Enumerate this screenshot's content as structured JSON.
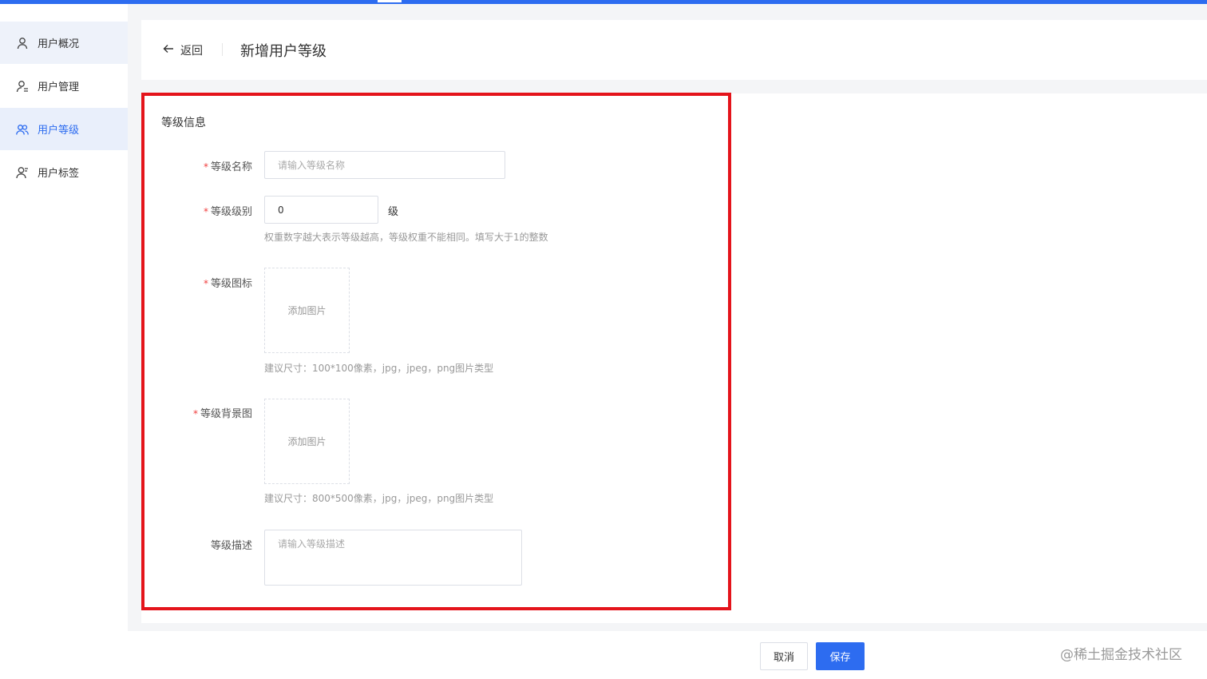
{
  "colors": {
    "primary": "#2d6cf0",
    "required": "#f03c3c",
    "highlight_border": "#e4141b"
  },
  "sidebar": {
    "items": [
      {
        "label": "用户概况",
        "icon": "user-icon",
        "state": "hover"
      },
      {
        "label": "用户管理",
        "icon": "user-list-icon",
        "state": "normal"
      },
      {
        "label": "用户等级",
        "icon": "user-group-icon",
        "state": "active"
      },
      {
        "label": "用户标签",
        "icon": "user-tag-icon",
        "state": "normal"
      }
    ]
  },
  "header": {
    "back_label": "返回",
    "title": "新增用户等级"
  },
  "form": {
    "section_title": "等级信息",
    "name": {
      "label": "等级名称",
      "placeholder": "请输入等级名称",
      "value": ""
    },
    "level": {
      "label": "等级级别",
      "value": "0",
      "unit": "级",
      "hint": "权重数字越大表示等级越高，等级权重不能相同。填写大于1的整数"
    },
    "icon": {
      "label": "等级图标",
      "upload_label": "添加图片",
      "hint": "建议尺寸：100*100像素，jpg，jpeg，png图片类型"
    },
    "background": {
      "label": "等级背景图",
      "upload_label": "添加图片",
      "hint": "建议尺寸：800*500像素，jpg，jpeg，png图片类型"
    },
    "description": {
      "label": "等级描述",
      "placeholder": "请输入等级描述",
      "value": ""
    }
  },
  "footer": {
    "cancel_label": "取消",
    "save_label": "保存"
  },
  "watermark": "@稀土掘金技术社区"
}
